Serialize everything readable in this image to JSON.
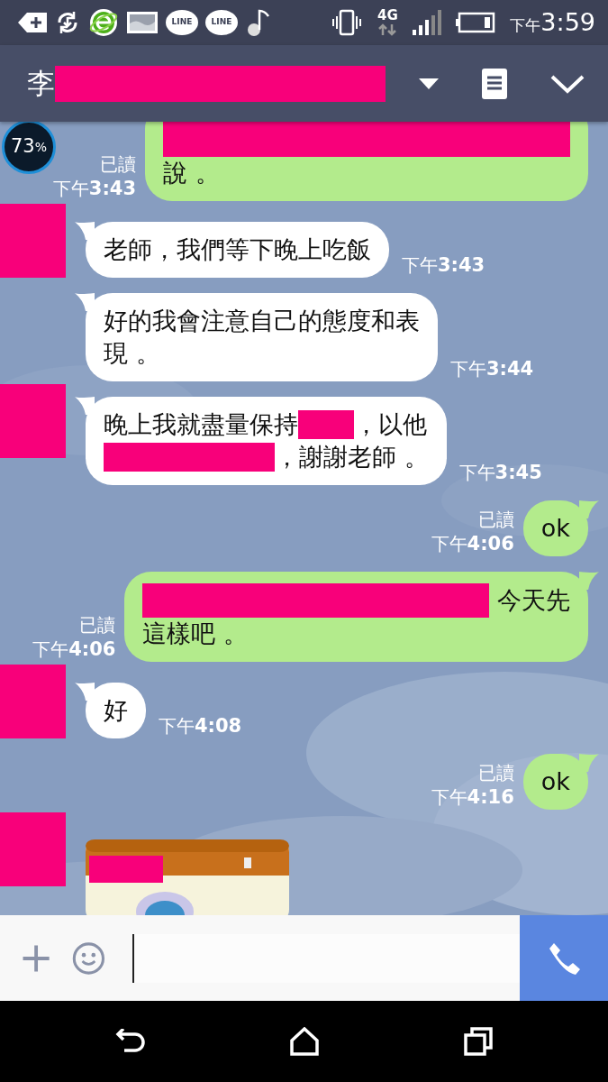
{
  "status_bar": {
    "line_badges": [
      "LINE",
      "LINE"
    ],
    "network": "4G",
    "time_prefix": "下午",
    "time": "3:59"
  },
  "header": {
    "title_parts": [
      {
        "kind": "text",
        "text": "李"
      },
      {
        "kind": "redacted-long"
      }
    ]
  },
  "overlay_widget": {
    "text": "73",
    "unit": "%"
  },
  "messages": [
    {
      "mine": true,
      "read": "已讀",
      "time": "下午**3:43**",
      "lines": [
        [
          {
            "kind": "redacted-full"
          }
        ],
        [
          {
            "kind": "text",
            "text": "說 。"
          }
        ]
      ]
    },
    {
      "mine": false,
      "avatar_redacted": true,
      "time": "下午**3:43**",
      "lines": [
        [
          {
            "kind": "text",
            "text": "老師，我們等下晚上吃飯"
          }
        ]
      ]
    },
    {
      "mine": false,
      "time": "下午**3:44**",
      "lines": [
        [
          {
            "kind": "text",
            "text": "好的我會注意自己的態度和表"
          }
        ],
        [
          {
            "kind": "text",
            "text": "現 。"
          }
        ]
      ]
    },
    {
      "mine": false,
      "avatar_redacted": true,
      "time": "下午**3:45**",
      "lines": [
        [
          {
            "kind": "text",
            "text": "晚上我就盡量保持"
          },
          {
            "kind": "redacted-short"
          },
          {
            "kind": "text",
            "text": "，以他"
          }
        ],
        [
          {
            "kind": "redacted-medium"
          },
          {
            "kind": "text",
            "text": "，謝謝老師 。"
          }
        ]
      ]
    },
    {
      "mine": true,
      "read": "已讀",
      "time": "下午**4:06**",
      "lines": [
        [
          {
            "kind": "text",
            "text": "ok"
          }
        ]
      ]
    },
    {
      "mine": true,
      "read": "已讀",
      "time": "下午**4:06**",
      "lines": [
        [
          {
            "kind": "redacted-long"
          },
          {
            "kind": "text",
            "text": " 今天先"
          }
        ],
        [
          {
            "kind": "text",
            "text": "這樣吧 。"
          }
        ]
      ]
    },
    {
      "mine": false,
      "avatar_redacted": true,
      "time": "下午**4:08**",
      "lines": [
        [
          {
            "kind": "text",
            "text": "好"
          }
        ]
      ]
    },
    {
      "mine": true,
      "read": "已讀",
      "time": "下午**4:16**",
      "lines": [
        [
          {
            "kind": "text",
            "text": "ok"
          }
        ]
      ]
    },
    {
      "mine": false,
      "avatar_redacted": true,
      "kind": "picture"
    }
  ]
}
